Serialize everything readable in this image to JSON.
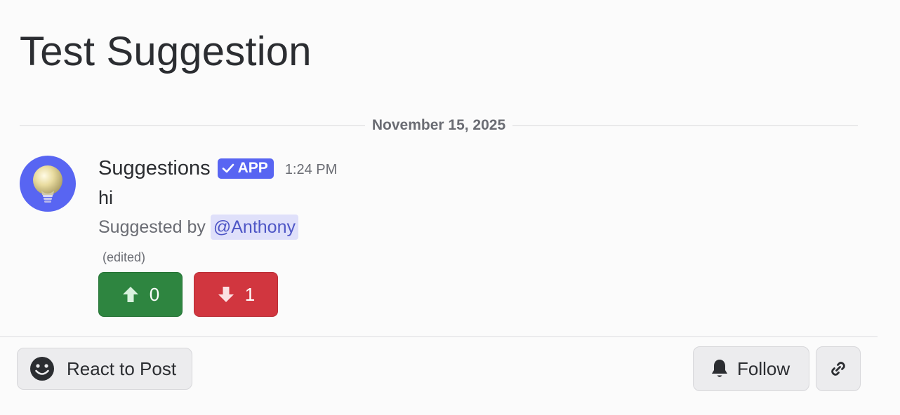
{
  "post": {
    "title": "Test Suggestion"
  },
  "date_divider": {
    "label": "November 15, 2025"
  },
  "message": {
    "author": "Suggestions",
    "app_tag": "APP",
    "timestamp": "1:24 PM",
    "content": "hi",
    "suggested_prefix": "Suggested by",
    "mention": "@Anthony",
    "edited": "(edited)",
    "avatar_icon": "lightbulb-icon"
  },
  "votes": {
    "upvote": {
      "icon": "arrow-up-icon",
      "count": "0",
      "color": "#2e8540"
    },
    "downvote": {
      "icon": "arrow-down-icon",
      "count": "1",
      "color": "#d1363f"
    }
  },
  "footer": {
    "react_label": "React to Post",
    "react_icon": "smiley-icon",
    "follow_label": "Follow",
    "follow_icon": "bell-icon",
    "link_icon": "link-icon"
  },
  "colors": {
    "brand": "#5865f2",
    "mention_bg": "#dfe0fa",
    "mention_text": "#4e56c6"
  }
}
